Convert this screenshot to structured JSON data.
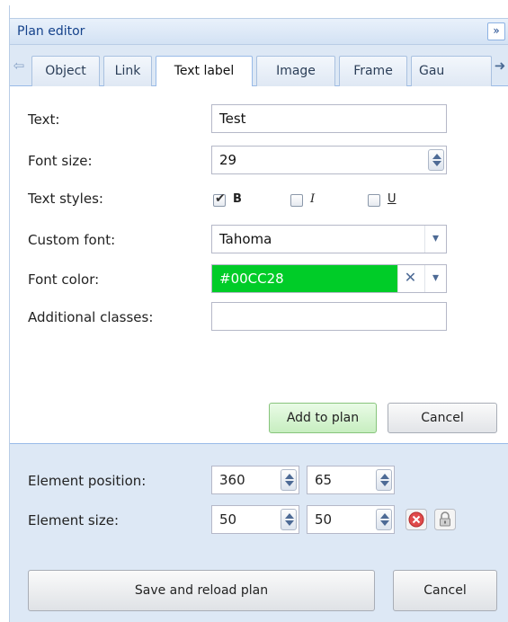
{
  "header": {
    "title": "Plan editor",
    "collapse_glyph": "»"
  },
  "tabs": [
    {
      "label": "Object",
      "active": false
    },
    {
      "label": "Link",
      "active": false
    },
    {
      "label": "Text label",
      "active": true
    },
    {
      "label": "Image",
      "active": false
    },
    {
      "label": "Frame",
      "active": false
    },
    {
      "label": "Gau",
      "active": false
    }
  ],
  "tab_scroll": {
    "left": "⇦",
    "right": "➜"
  },
  "form": {
    "text": {
      "label": "Text:",
      "value": "Test"
    },
    "font_size": {
      "label": "Font size:",
      "value": "29"
    },
    "text_styles": {
      "label": "Text styles:",
      "options": [
        {
          "label": "B",
          "checked": true
        },
        {
          "label": "I",
          "checked": false
        },
        {
          "label": "U",
          "checked": false
        }
      ]
    },
    "custom_font": {
      "label": "Custom font:",
      "value": "Tahoma"
    },
    "font_color": {
      "label": "Font color:",
      "value": "#00CC28",
      "color": "#00cc28"
    },
    "additional_classes": {
      "label": "Additional classes:",
      "value": ""
    }
  },
  "form_buttons": {
    "add": "Add to plan",
    "cancel": "Cancel"
  },
  "element": {
    "position": {
      "label": "Element position:",
      "x": "360",
      "y": "65"
    },
    "size": {
      "label": "Element size:",
      "w": "50",
      "h": "50"
    }
  },
  "footer_buttons": {
    "save": "Save and reload plan",
    "cancel": "Cancel"
  },
  "icons": {
    "remove": "remove-icon",
    "lock": "lock-icon",
    "dropdown": "chevron-down-icon",
    "clear": "clear-icon"
  }
}
